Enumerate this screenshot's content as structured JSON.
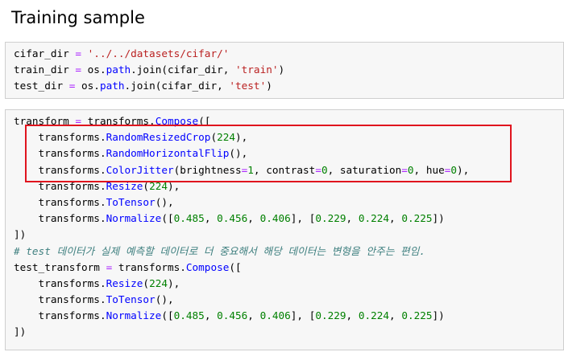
{
  "heading": "Training sample",
  "colors": {
    "string": "#ba2121",
    "operator": "#aa22ff",
    "number": "#008000",
    "member": "#0000ff",
    "comment": "#408080",
    "highlight": "#e0141e",
    "cell_background": "#f7f7f7"
  },
  "cell1": {
    "l1": {
      "a": "cifar_dir ",
      "op": "=",
      "b": " ",
      "str": "'../../datasets/cifar/'"
    },
    "l2": {
      "a": "train_dir ",
      "op": "=",
      "b": " os.",
      "m": "path",
      "c": ".join(cifar_dir, ",
      "str": "'train'",
      "d": ")"
    },
    "l3": {
      "a": "test_dir ",
      "op": "=",
      "b": " os.",
      "m": "path",
      "c": ".join(cifar_dir, ",
      "str": "'test'",
      "d": ")"
    }
  },
  "cell2": {
    "l1": {
      "a": "transform ",
      "op": "=",
      "b": " transforms.",
      "m": "Compose",
      "c": "(["
    },
    "l2": {
      "a": "    transforms.",
      "m": "RandomResizedCrop",
      "b": "(",
      "n": "224",
      "c": "),"
    },
    "l3": {
      "a": "    transforms.",
      "m": "RandomHorizontalFlip",
      "b": "(),"
    },
    "l4": {
      "a": "    transforms.",
      "m": "ColorJitter",
      "b": "(brightness",
      "op1": "=",
      "n1": "1",
      "c": ", contrast",
      "op2": "=",
      "n2": "0",
      "d": ", saturation",
      "op3": "=",
      "n3": "0",
      "e": ", hue",
      "op4": "=",
      "n4": "0",
      "f": "),"
    },
    "l5": {
      "a": "    transforms.",
      "m": "Resize",
      "b": "(",
      "n": "224",
      "c": "),"
    },
    "l6": {
      "a": "    transforms.",
      "m": "ToTensor",
      "b": "(),"
    },
    "l7": {
      "a": "    transforms.",
      "m": "Normalize",
      "b": "([",
      "n1": "0.485",
      "c1": ", ",
      "n2": "0.456",
      "c2": ", ",
      "n3": "0.406",
      "c3": "], [",
      "n4": "0.229",
      "c4": ", ",
      "n5": "0.224",
      "c5": ", ",
      "n6": "0.225",
      "c6": "])"
    },
    "l8": {
      "a": "])"
    },
    "l9": {
      "comment": "# test 데이터가 실제 예측할 데이터로 더 중요해서 해당 데이터는 변형을 안주는 편임."
    },
    "l10": {
      "a": "test_transform ",
      "op": "=",
      "b": " transforms.",
      "m": "Compose",
      "c": "(["
    },
    "l11": {
      "a": "    transforms.",
      "m": "Resize",
      "b": "(",
      "n": "224",
      "c": "),"
    },
    "l12": {
      "a": "    transforms.",
      "m": "ToTensor",
      "b": "(),"
    },
    "l13": {
      "a": "    transforms.",
      "m": "Normalize",
      "b": "([",
      "n1": "0.485",
      "c1": ", ",
      "n2": "0.456",
      "c2": ", ",
      "n3": "0.406",
      "c3": "], [",
      "n4": "0.229",
      "c4": ", ",
      "n5": "0.224",
      "c5": ", ",
      "n6": "0.225",
      "c6": "])"
    },
    "l14": {
      "a": "])"
    }
  }
}
